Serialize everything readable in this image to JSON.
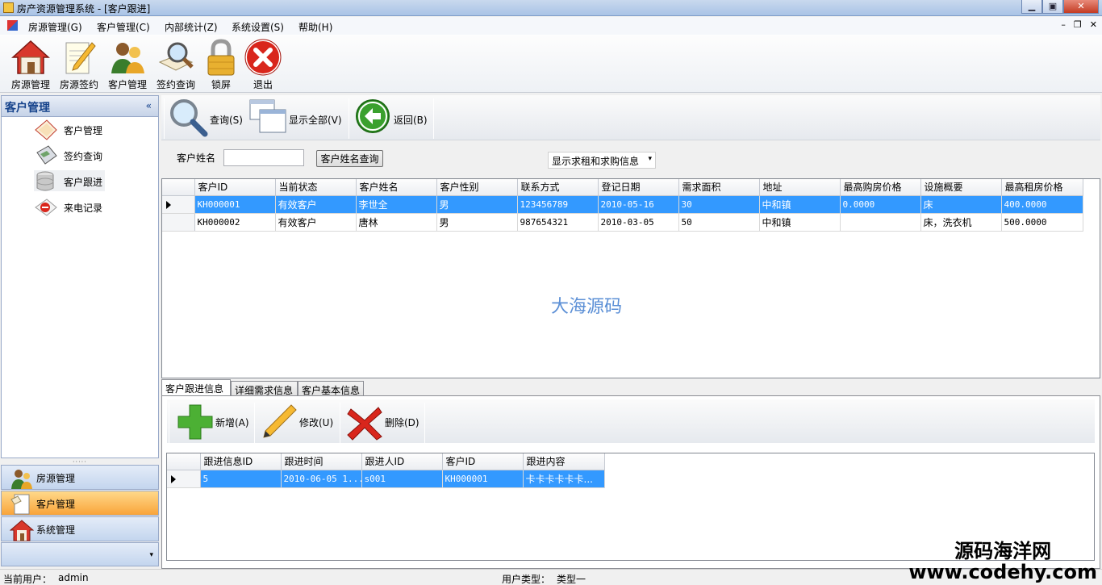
{
  "window": {
    "title": "房产资源管理系统 - [客户跟进]"
  },
  "menu": [
    "房源管理(G)",
    "客户管理(C)",
    "内部统计(Z)",
    "系统设置(S)",
    "帮助(H)"
  ],
  "toolbar": [
    {
      "label": "房源管理",
      "icon": "house-icon"
    },
    {
      "label": "房源签约",
      "icon": "notepad-pencil-icon"
    },
    {
      "label": "客户管理",
      "icon": "users-icon"
    },
    {
      "label": "签约查询",
      "icon": "magnifier-book-icon"
    },
    {
      "label": "锁屏",
      "icon": "padlock-icon"
    },
    {
      "label": "退出",
      "icon": "red-x-icon"
    }
  ],
  "left_panel": {
    "title": "客户管理",
    "collapse": "«",
    "items": [
      "客户管理",
      "签约查询",
      "客户跟进",
      "来电记录"
    ],
    "active_item": "客户跟进",
    "splitter": "·····",
    "groups": [
      "房源管理",
      "客户管理",
      "系统管理"
    ],
    "active_group": "客户管理",
    "footer_chevron": "▾"
  },
  "main_toolbar": {
    "query": "查询(S)",
    "show_all": "显示全部(V)",
    "back": "返回(B)"
  },
  "search": {
    "label": "客户姓名",
    "value": "",
    "button": "客户姓名查询",
    "filter": "显示求租和求购信息",
    "filter_arrow": "▾"
  },
  "customer_grid": {
    "columns": [
      "客户ID",
      "当前状态",
      "客户姓名",
      "客户性别",
      "联系方式",
      "登记日期",
      "需求面积",
      "地址",
      "最高购房价格",
      "设施概要",
      "最高租房价格"
    ],
    "rows": [
      [
        "KH000001",
        "有效客户",
        "李世全",
        "男",
        "123456789",
        "2010-05-16",
        "30",
        "中和镇",
        "0.0000",
        "床",
        "400.0000"
      ],
      [
        "KH000002",
        "有效客户",
        "唐林",
        "男",
        "987654321",
        "2010-03-05",
        "50",
        "中和镇",
        "",
        "床，洗衣机",
        "500.0000"
      ]
    ],
    "selected_row": 0
  },
  "center_watermark": "大海源码",
  "tabs": [
    "客户跟进信息",
    "详细需求信息",
    "客户基本信息"
  ],
  "active_tab": 0,
  "sub_toolbar": {
    "add": "新增(A)",
    "edit": "修改(U)",
    "delete": "删除(D)"
  },
  "followup_grid": {
    "columns": [
      "跟进信息ID",
      "跟进时间",
      "跟进人ID",
      "客户ID",
      "跟进内容"
    ],
    "rows": [
      [
        "5",
        "2010-06-05 1...",
        "s001",
        "KH000001",
        "卡卡卡卡卡卡..."
      ]
    ],
    "selected_row": 0
  },
  "status": {
    "user_label": "当前用户：",
    "user": "admin",
    "type_label": "用户类型：",
    "type": "类型一"
  },
  "corner_watermark": {
    "line1": "源码海洋网",
    "line2": "www.codehy.com"
  },
  "colors": {
    "selection": "#3399ff",
    "active_group": "#f9a43a",
    "panel_title": "#15428b"
  }
}
